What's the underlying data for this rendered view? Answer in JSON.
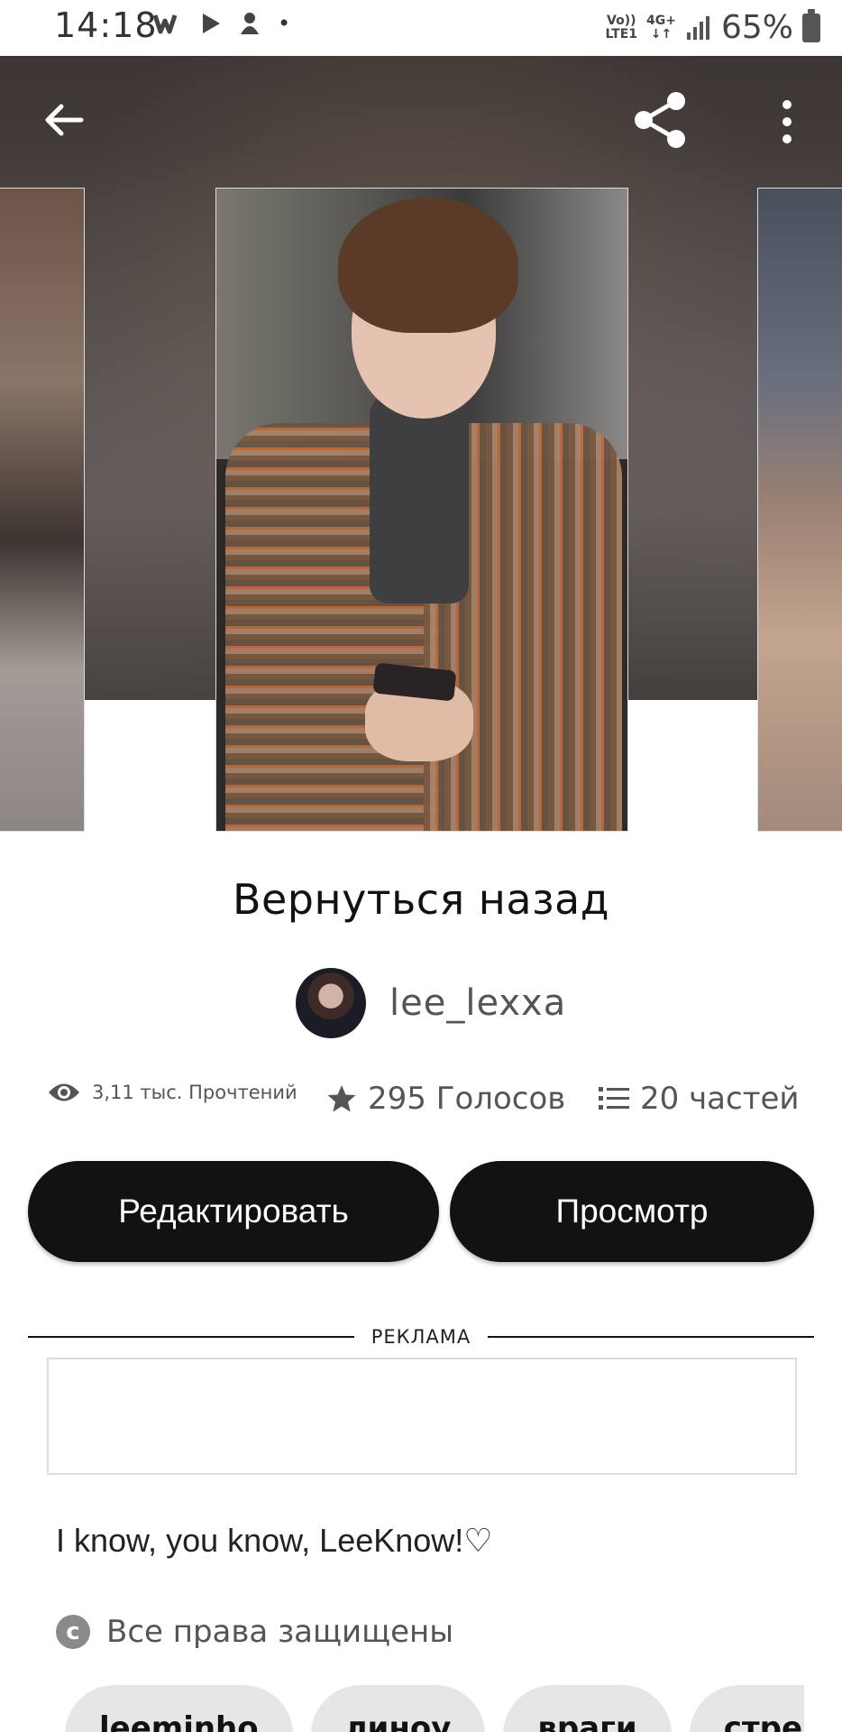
{
  "status_bar": {
    "time": "14:18",
    "network_top": "Vo))",
    "network_bottom": "LTE1",
    "network_type": "4G+",
    "battery": "65%"
  },
  "header": {
    "back_icon": "arrow-left-icon",
    "share_icon": "share-icon",
    "more_icon": "more-vertical-icon"
  },
  "story": {
    "title": "Вернуться назад",
    "author": "lee_lexxa",
    "reads": "3,11 тыс. Прочтений",
    "votes": "295 Голосов",
    "parts": "20 частей",
    "description": "I know, you know, LeeKnow!♡",
    "copyright": "Все права защищены"
  },
  "actions": {
    "edit_label": "Редактировать",
    "view_label": "Просмотр"
  },
  "ad": {
    "label": "РЕКЛАМА"
  },
  "tags": [
    "leeminho",
    "линоу",
    "враги",
    "стрей"
  ]
}
